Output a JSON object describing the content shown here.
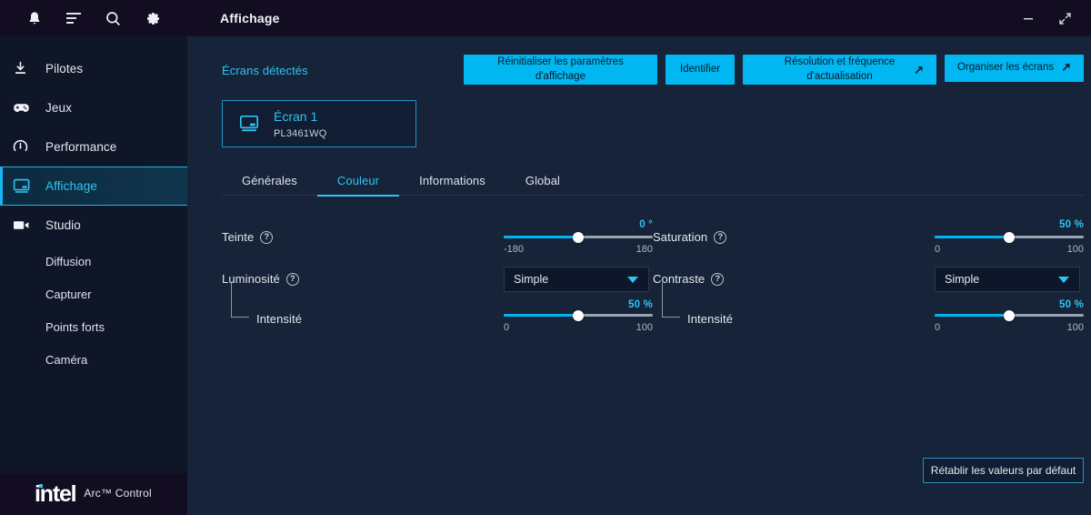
{
  "window": {
    "title": "Affichage",
    "controls": {
      "minimize": "minimize-icon",
      "maximize": "maximize-icon",
      "close": "close-icon"
    }
  },
  "sidebar": {
    "toolbar_icons": [
      "bell-icon",
      "menu-lines-icon",
      "search-icon",
      "gear-icon"
    ],
    "items": [
      {
        "label": "Pilotes",
        "icon": "download-icon",
        "active": false,
        "sub": false
      },
      {
        "label": "Jeux",
        "icon": "gamepad-icon",
        "active": false,
        "sub": false
      },
      {
        "label": "Performance",
        "icon": "speedometer-icon",
        "active": false,
        "sub": false
      },
      {
        "label": "Affichage",
        "icon": "monitor-icon",
        "active": true,
        "sub": false
      },
      {
        "label": "Studio",
        "icon": "video-camera-icon",
        "active": false,
        "sub": false
      },
      {
        "label": "Diffusion",
        "icon": "",
        "active": false,
        "sub": true
      },
      {
        "label": "Capturer",
        "icon": "",
        "active": false,
        "sub": true
      },
      {
        "label": "Points forts",
        "icon": "",
        "active": false,
        "sub": true
      },
      {
        "label": "Caméra",
        "icon": "",
        "active": false,
        "sub": true
      }
    ],
    "brand": {
      "logo_text": "intel",
      "product": "Arc™ Control"
    }
  },
  "main": {
    "detected_label": "Écrans détectés",
    "buttons": {
      "reset_display": "Réinitialiser les paramètres d'affichage",
      "identify": "Identifier",
      "resolution": "Résolution et fréquence d'actualisation",
      "arrange": "Organiser les écrans",
      "external_arrow": "↗"
    },
    "monitor": {
      "name": "Écran 1",
      "model": "PL3461WQ",
      "icon": "monitor-icon"
    },
    "tabs": [
      {
        "label": "Générales",
        "active": false
      },
      {
        "label": "Couleur",
        "active": true
      },
      {
        "label": "Informations",
        "active": false
      },
      {
        "label": "Global",
        "active": false
      }
    ],
    "settings": {
      "hue": {
        "label": "Teinte",
        "help": "?",
        "value": "0 °",
        "min": "-180",
        "max": "180",
        "percent": 50
      },
      "saturation": {
        "label": "Saturation",
        "help": "?",
        "value": "50 %",
        "min": "0",
        "max": "100",
        "percent": 50
      },
      "brightness": {
        "label": "Luminosité",
        "help": "?",
        "mode": "Simple",
        "child_label": "Intensité",
        "value": "50 %",
        "min": "0",
        "max": "100",
        "percent": 50
      },
      "contrast": {
        "label": "Contraste",
        "help": "?",
        "mode": "Simple",
        "child_label": "Intensité",
        "value": "50 %",
        "min": "0",
        "max": "100",
        "percent": 50
      }
    },
    "restore_defaults": "Rétablir les valeurs par défaut"
  },
  "colors": {
    "accent": "#2fc4f5",
    "button_cyan": "#00b7f1",
    "sidebar_bg": "#0e1627",
    "main_bg": "#172338",
    "titlebar_bg": "#120d21"
  }
}
